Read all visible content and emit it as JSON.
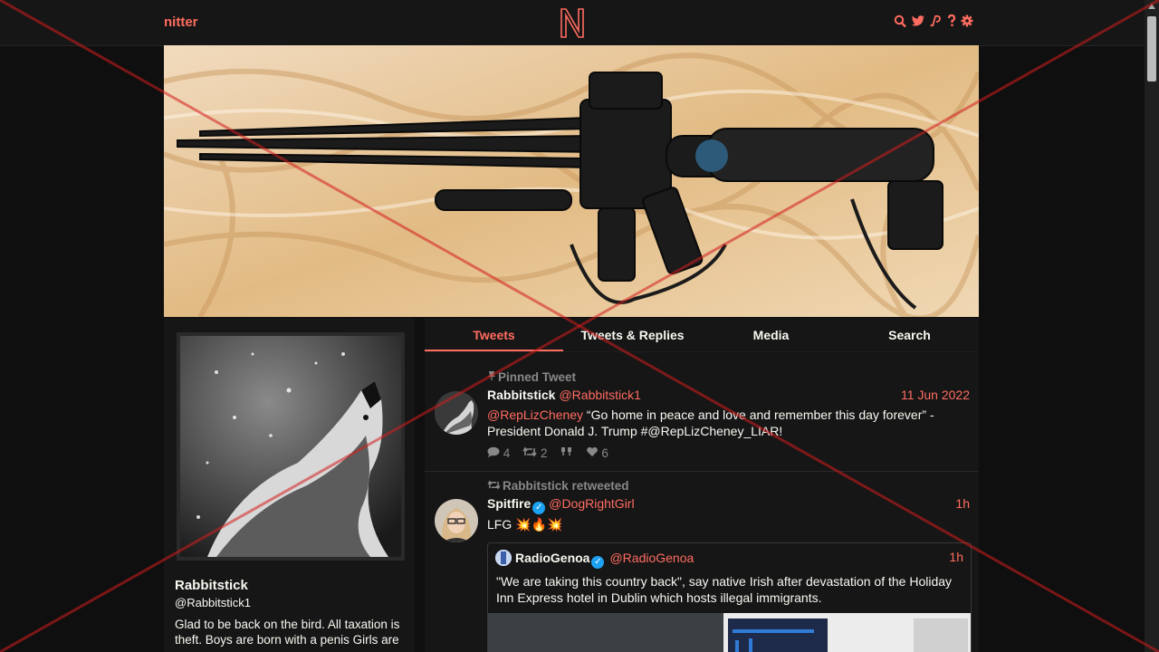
{
  "nav": {
    "brand": "nitter",
    "logo_letter": "N",
    "icons": [
      "search-icon",
      "twitter-icon",
      "rss-icon",
      "help-icon",
      "settings-icon"
    ],
    "accent": "#ff6c60"
  },
  "profile": {
    "fullname": "Rabbitstick",
    "username": "@Rabbitstick1",
    "bio": "Glad to be back on the bird. All taxation is theft. Boys are born with a penis Girls are"
  },
  "tabs": [
    {
      "label": "Tweets",
      "active": true
    },
    {
      "label": "Tweets & Replies",
      "active": false
    },
    {
      "label": "Media",
      "active": false
    },
    {
      "label": "Search",
      "active": false
    }
  ],
  "tweets": [
    {
      "context": "Pinned Tweet",
      "fullname": "Rabbitstick",
      "username": "@Rabbitstick1",
      "date": "11 Jun 2022",
      "mention": "@RepLizCheney",
      "text": " “Go home in peace and love and remember this day forever” - President Donald J. Trump #@RepLizCheney_LIAR!",
      "stats": {
        "replies": "4",
        "retweets": "2",
        "quotes": "",
        "likes": "6"
      }
    },
    {
      "context": "Rabbitstick retweeted",
      "fullname": "Spitfire",
      "username": "@DogRightGirl",
      "date": "1h",
      "text": "LFG 💥🔥💥",
      "quote": {
        "fullname": "RadioGenoa",
        "username": "@RadioGenoa",
        "date": "1h",
        "text": "\"We are taking this country back\", say native Irish after devastation of the Holiday Inn Express hotel in Dublin which hosts illegal immigrants."
      }
    }
  ]
}
